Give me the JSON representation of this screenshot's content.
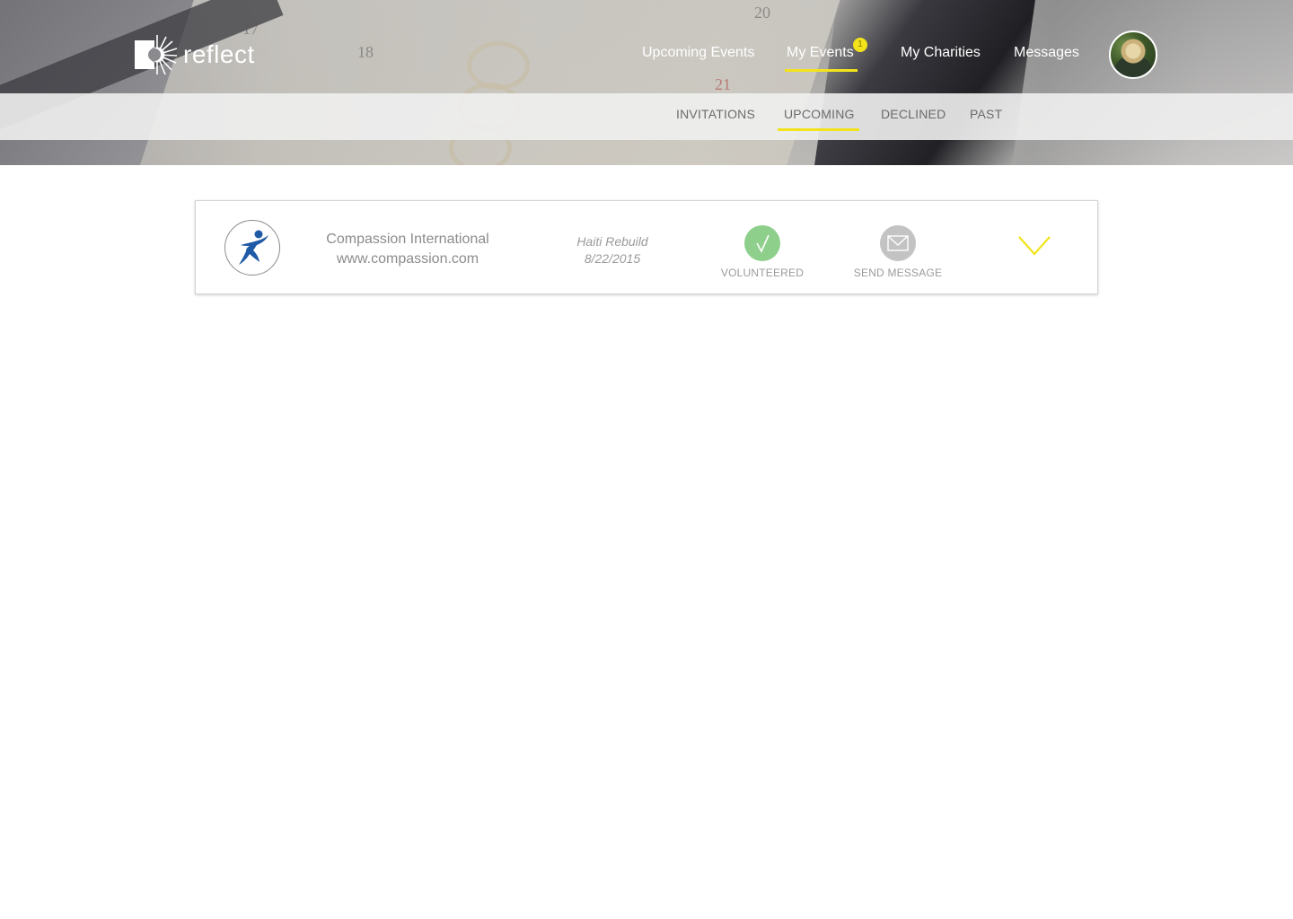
{
  "app": {
    "brand": "reflect"
  },
  "topnav": {
    "items": [
      {
        "label": "Upcoming Events",
        "active": false
      },
      {
        "label": "My Events",
        "active": true,
        "badge": "1"
      },
      {
        "label": "My Charities",
        "active": false
      },
      {
        "label": "Messages",
        "active": false
      }
    ]
  },
  "subnav": {
    "tabs": [
      {
        "label": "INVITATIONS",
        "active": false
      },
      {
        "label": "UPCOMING",
        "active": true
      },
      {
        "label": "DECLINED",
        "active": false
      },
      {
        "label": "PAST",
        "active": false
      }
    ]
  },
  "events": [
    {
      "organization": "Compassion International",
      "website": "www.compassion.com",
      "event_name": "Haiti Rebuild",
      "event_date": "8/22/2015",
      "status_label": "VOLUNTEERED",
      "message_label": "SEND MESSAGE",
      "status_icon": "checkmark-icon",
      "message_icon": "envelope-icon",
      "expand_icon": "chevron-down-icon"
    }
  ],
  "colors": {
    "accent": "#f2e31a",
    "volunteered": "#8fcf8c",
    "message": "#c3c3c3",
    "text_muted": "#8c8c8c",
    "org_logo_blue": "#1f5aa6"
  }
}
